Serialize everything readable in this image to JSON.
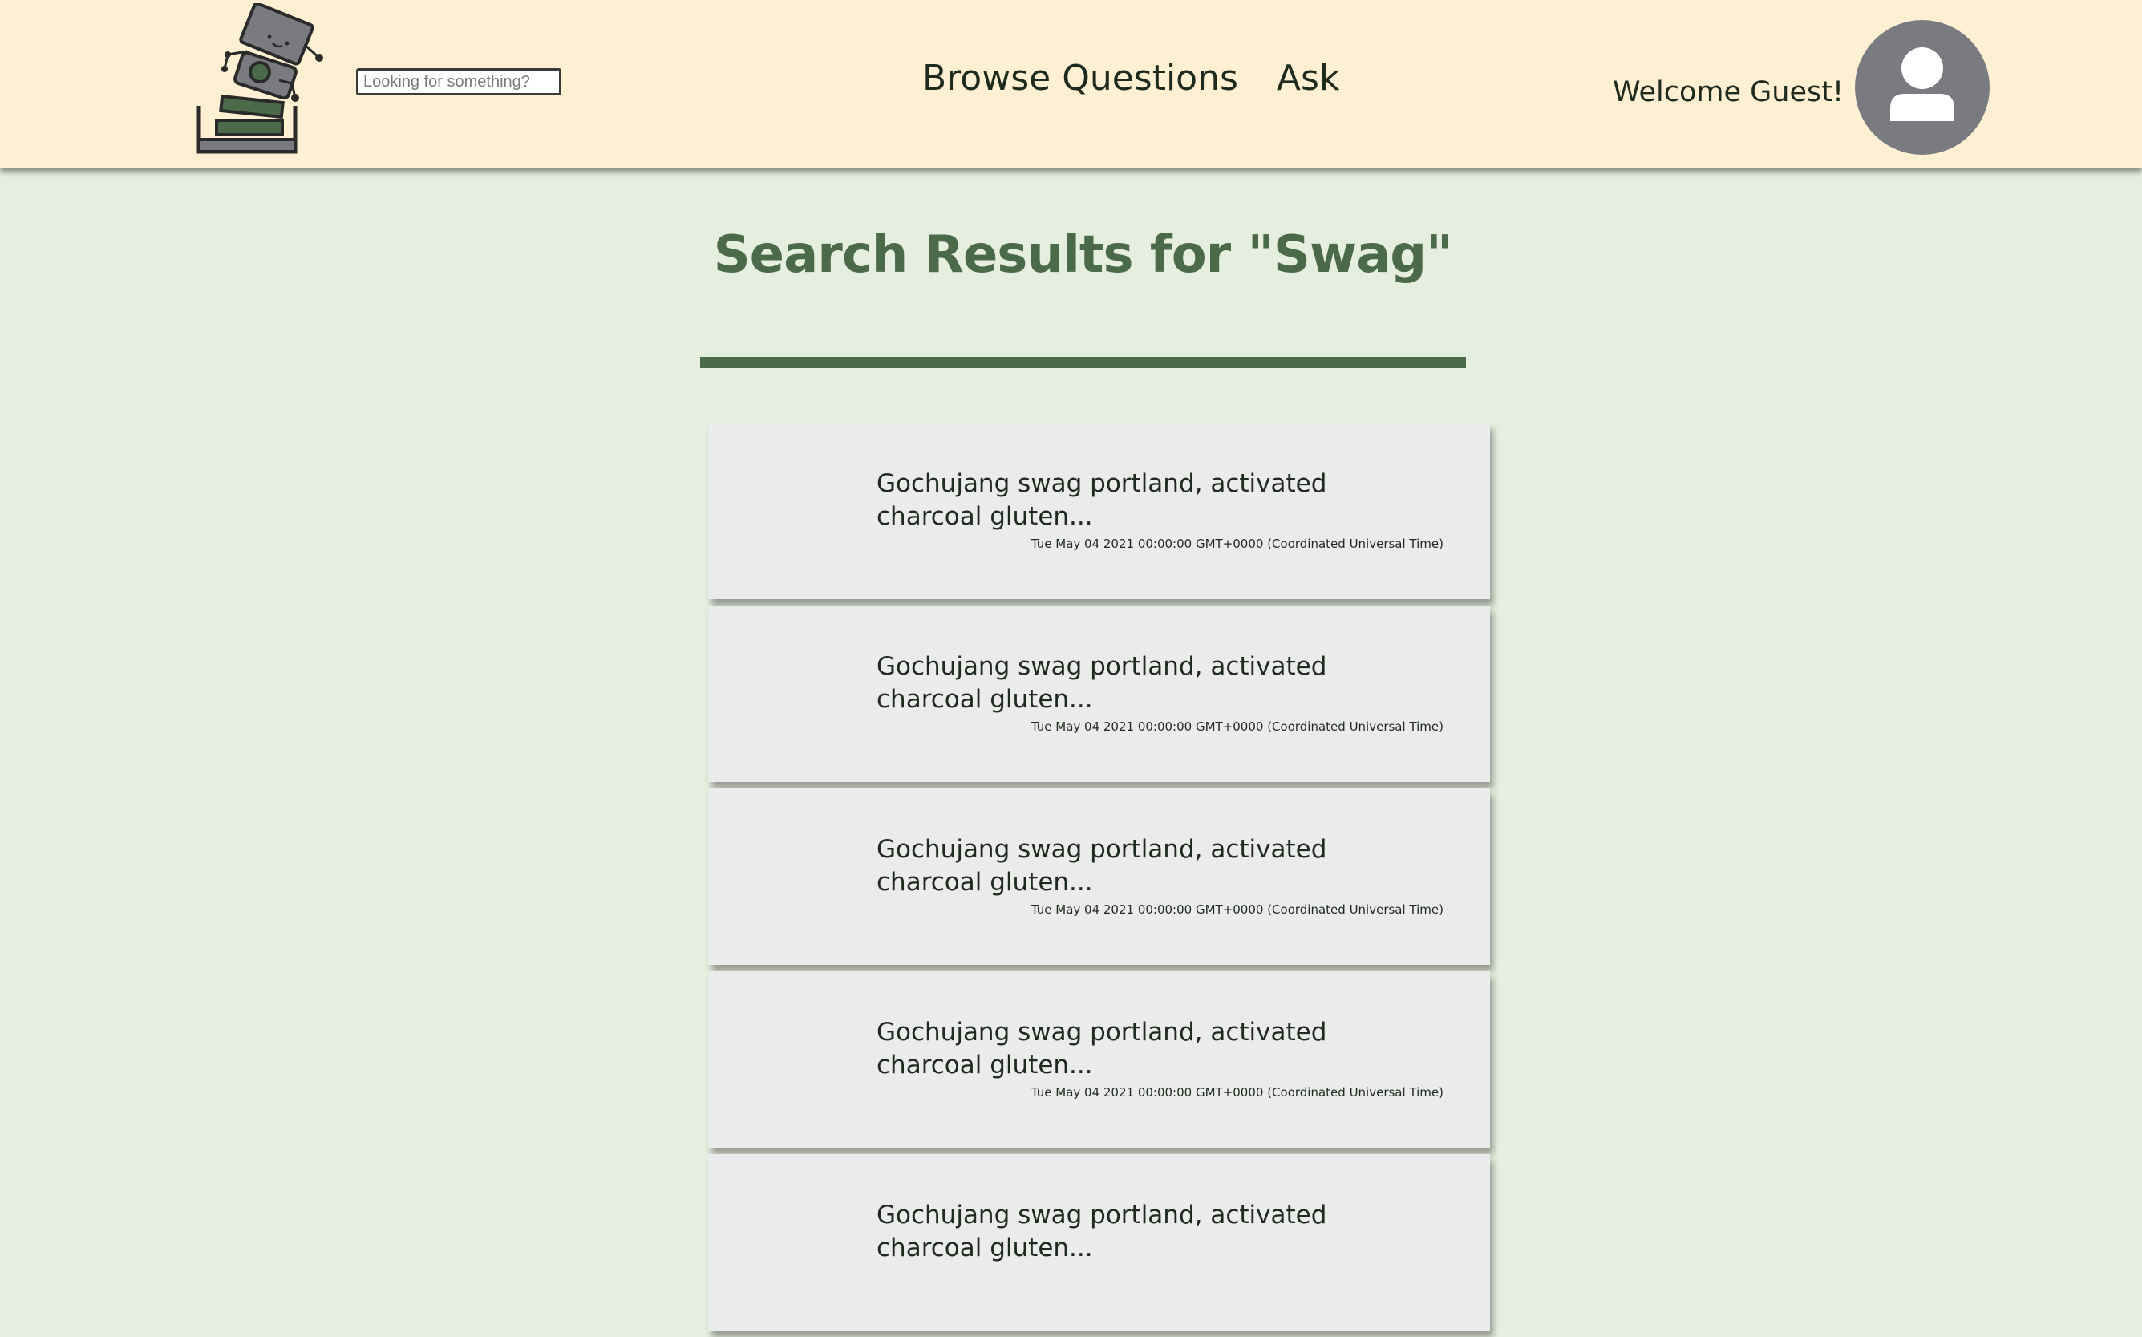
{
  "header": {
    "logo_icon": "robot-books-logo-icon",
    "search": {
      "placeholder": "Looking for something?",
      "value": ""
    },
    "nav": [
      {
        "label": "Browse Questions"
      },
      {
        "label": "Ask"
      }
    ],
    "welcome": "Welcome Guest!",
    "avatar_icon": "user-avatar-icon"
  },
  "main": {
    "title": "Search Results for \"Swag\"",
    "results": [
      {
        "title": "Gochujang swag portland, activated charcoal gluten...",
        "date": "Tue May 04 2021 00:00:00 GMT+0000 (Coordinated Universal Time)"
      },
      {
        "title": "Gochujang swag portland, activated charcoal gluten...",
        "date": "Tue May 04 2021 00:00:00 GMT+0000 (Coordinated Universal Time)"
      },
      {
        "title": "Gochujang swag portland, activated charcoal gluten...",
        "date": "Tue May 04 2021 00:00:00 GMT+0000 (Coordinated Universal Time)"
      },
      {
        "title": "Gochujang swag portland, activated charcoal gluten...",
        "date": "Tue May 04 2021 00:00:00 GMT+0000 (Coordinated Universal Time)"
      },
      {
        "title": "Gochujang swag portland, activated charcoal gluten...",
        "date": ""
      }
    ]
  },
  "colors": {
    "header_bg": "#fff0d4",
    "page_bg": "#e6eedf",
    "accent_green": "#4a6a4a",
    "card_bg": "#ebebeb",
    "avatar_bg": "#7a7b80"
  }
}
